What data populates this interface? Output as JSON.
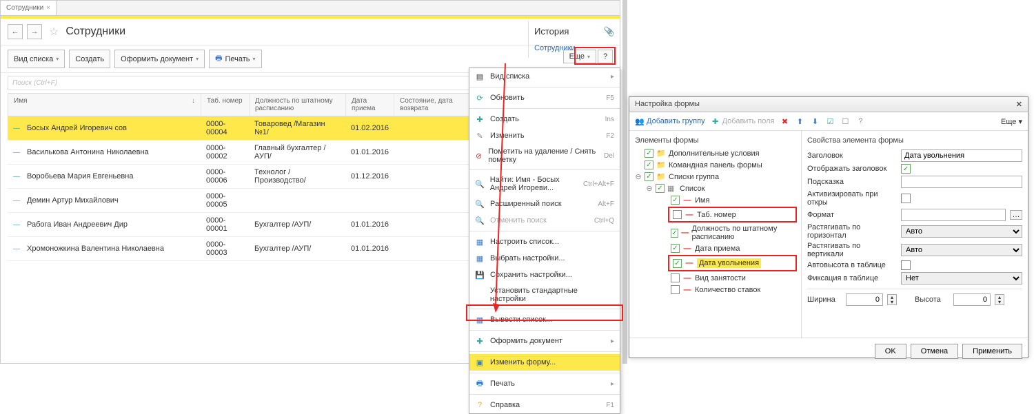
{
  "tab": {
    "label": "Сотрудники",
    "close": "×"
  },
  "nav": {
    "back": "←",
    "fwd": "→"
  },
  "title": "Сотрудники",
  "toolbar": {
    "viewList": "Вид списка",
    "create": "Создать",
    "makeDoc": "Оформить документ",
    "print": "Печать",
    "more": "Еще",
    "help": "?"
  },
  "search": {
    "placeholder": "Поиск (Ctrl+F)"
  },
  "history": {
    "title": "История",
    "link": "Сотрудники"
  },
  "columns": {
    "name": "Имя",
    "sortMark": "↓",
    "num": "Таб. номер",
    "pos": "Должность по штатному расписанию",
    "date": "Дата приема",
    "state": "Состояние, дата возврата"
  },
  "rows": [
    {
      "name": "Босых Андрей Игоревич сов",
      "num": "0000-00004",
      "pos": "Товаровед /Магазин №1/",
      "date": "01.02.2016",
      "selected": true
    },
    {
      "name": "Василькова Антонина Николаевна",
      "num": "0000-00002",
      "pos": "Главный бухгалтер /АУП/",
      "date": "01.01.2016"
    },
    {
      "name": "Воробьева Мария Евгеньевна",
      "num": "0000-00006",
      "pos": "Технолог /Производство/",
      "date": "01.12.2016"
    },
    {
      "name": "Демин Артур Михайлович",
      "num": "0000-00005",
      "pos": "",
      "date": ""
    },
    {
      "name": "Рабога Иван Андреевич Дир",
      "num": "0000-00001",
      "pos": "Бухгалтер /АУП/",
      "date": "01.01.2016"
    },
    {
      "name": "Хромоножкина Валентина Николаевна",
      "num": "0000-00003",
      "pos": "Бухгалтер /АУП/",
      "date": "01.01.2016"
    }
  ],
  "menu": {
    "viewList": "Вид списка",
    "refresh": "Обновить",
    "refreshSc": "F5",
    "create": "Создать",
    "createSc": "Ins",
    "edit": "Изменить",
    "editSc": "F2",
    "delete": "Пометить на удаление / Снять пометку",
    "deleteSc": "Del",
    "find": "Найти: Имя - Босых Андрей Игореви...",
    "findSc": "Ctrl+Alt+F",
    "advFind": "Расширенный поиск",
    "advFindSc": "Alt+F",
    "cancelFind": "Отменить поиск",
    "cancelFindSc": "Ctrl+Q",
    "listSettings": "Настроить список...",
    "chooseSettings": "Выбрать настройки...",
    "saveSettings": "Сохранить настройки...",
    "stdSettings": "Установить стандартные настройки",
    "outputList": "Вывести список...",
    "makeDoc": "Оформить документ",
    "changeForm": "Изменить форму...",
    "print": "Печать",
    "help": "Справка",
    "helpSc": "F1"
  },
  "dialog": {
    "title": "Настройка формы",
    "addGroup": "Добавить группу",
    "addFields": "Добавить поля",
    "moreLabel": "Еще",
    "treeTitle": "Элементы формы",
    "propsTitle": "Свойства элемента формы",
    "tree": {
      "addCond": "Дополнительные условия",
      "cmdPanel": "Командная панель формы",
      "listsGroup": "Списки группа",
      "list": "Список",
      "name": "Имя",
      "tabNum": "Таб. номер",
      "position": "Должность по штатному расписанию",
      "hireDate": "Дата приема",
      "fireDate": "Дата увольнения",
      "empType": "Вид занятости",
      "rateCount": "Количество ставок"
    },
    "props": {
      "header": "Заголовок",
      "headerVal": "Дата увольнения",
      "showHeader": "Отображать заголовок",
      "hint": "Подсказка",
      "activate": "Активизировать при откры",
      "format": "Формат",
      "stretchH": "Растягивать по горизонтал",
      "stretchHVal": "Авто",
      "stretchV": "Растягивать по вертикали",
      "stretchVVal": "Авто",
      "autoH": "Автовысота в таблице",
      "fix": "Фиксация в таблице",
      "fixVal": "Нет",
      "width": "Ширина",
      "widthVal": "0",
      "height": "Высота",
      "heightVal": "0"
    },
    "footer": {
      "ok": "OK",
      "cancel": "Отмена",
      "apply": "Применить"
    }
  }
}
